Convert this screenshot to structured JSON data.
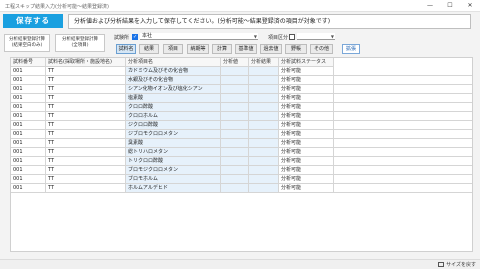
{
  "window": {
    "title": "工程スキップ結果入力(分析可能～結果登録済)",
    "minimize": "—",
    "maximize": "☐",
    "close": "✕"
  },
  "toolbar": {
    "save_label": "保存する",
    "message": "分析値および分析結果を入力して保存してください。(分析可能～結果登録済の項目が対象です)"
  },
  "flow_buttons": [
    {
      "line1": "分析結果登録計算",
      "line2": "(結果空白のみ)"
    },
    {
      "line1": "分析結果登録計算",
      "line2": "(全項目)"
    }
  ],
  "filters": {
    "lab_label": "試験所",
    "lab_value": "本社",
    "lab_checked": true,
    "category_label": "項目区分",
    "category_checked": false
  },
  "segments": [
    "試料名",
    "結果",
    "項目",
    "納期等",
    "計算",
    "基準値",
    "過去値",
    "野帳",
    "その他",
    "拡張"
  ],
  "selected_segment": "試料名",
  "table": {
    "headers": [
      "試料番号",
      "試料名(採取場所・施設地名)",
      "分析項目名",
      "分析値",
      "分析結果",
      "分析試料ステータス"
    ],
    "rows": [
      [
        "001",
        "TT",
        "カドミウム及びその化合物",
        "",
        "",
        "分析可能"
      ],
      [
        "001",
        "TT",
        "水銀及びその化合物",
        "",
        "",
        "分析可能"
      ],
      [
        "001",
        "TT",
        "シアン化物イオン及び塩化シアン",
        "",
        "",
        "分析可能"
      ],
      [
        "001",
        "TT",
        "塩素酸",
        "",
        "",
        "分析可能"
      ],
      [
        "001",
        "TT",
        "クロロ酢酸",
        "",
        "",
        "分析可能"
      ],
      [
        "001",
        "TT",
        "クロロホルム",
        "",
        "",
        "分析可能"
      ],
      [
        "001",
        "TT",
        "ジクロロ酢酸",
        "",
        "",
        "分析可能"
      ],
      [
        "001",
        "TT",
        "ジブロモクロロメタン",
        "",
        "",
        "分析可能"
      ],
      [
        "001",
        "TT",
        "臭素酸",
        "",
        "",
        "分析可能"
      ],
      [
        "001",
        "TT",
        "総トリハロメタン",
        "",
        "",
        "分析可能"
      ],
      [
        "001",
        "TT",
        "トリクロロ酢酸",
        "",
        "",
        "分析可能"
      ],
      [
        "001",
        "TT",
        "ブロモジクロロメタン",
        "",
        "",
        "分析可能"
      ],
      [
        "001",
        "TT",
        "ブロモホルム",
        "",
        "",
        "分析可能"
      ],
      [
        "001",
        "TT",
        "ホルムアルデヒド",
        "",
        "",
        "分析可能"
      ]
    ]
  },
  "statusbar": {
    "restore_label": "サイズを戻す"
  },
  "colors": {
    "save_button": "#1aa0e0",
    "row_highlight": "#e6f1fb",
    "checkbox_checked": "#1a73e8"
  }
}
